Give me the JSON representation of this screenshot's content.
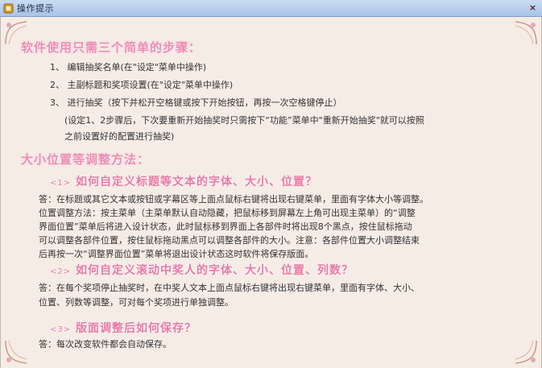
{
  "window": {
    "title": "操作提示",
    "close_label": "×"
  },
  "section1": {
    "heading": "软件使用只需三个简单的步骤：",
    "steps": [
      "1、 编辑抽奖名单(在\"设定\"菜单中操作)",
      "2、 主副标题和奖项设置(在\"设定\"菜单中操作)",
      "3、 进行抽奖（按下并松开空格键或按下开始按钮，再按一次空格键停止）"
    ],
    "note_lines": [
      "(设定1、2步骤后，下次要重新开始抽奖时只需按下“功能”菜单中\"重新开始抽奖\"就可以按照",
      "之前设置好的配置进行抽奖)"
    ]
  },
  "section2": {
    "heading": "大小位置等调整方法：",
    "questions": [
      {
        "num": "<1>",
        "title": "如何自定义标题等文本的字体、大小、位置？",
        "answer_lines": [
          "答：在标题或其它文本或按钮或字幕区等上面点鼠标右键将出现右键菜单，里面有字体大小等调整。",
          "位置调整方法：按主菜单（主菜单默认自动隐藏，把鼠标移到屏幕左上角可出现主菜单）的“调整",
          "界面位置”菜单后将进入设计状态，此时鼠标移到界面上各部件时将出现8个黑点，按住鼠标拖动",
          "可以调整各部件位置，按住鼠标拖动黑点可以调整各部件的大小。注意：各部件位置大小调整结束",
          "后再按一次“调整界面位置”菜单将退出设计状态这时软件将保存版面。"
        ]
      },
      {
        "num": "<2>",
        "title": "如何自定义滚动中奖人的字体、大小、位置、列数？",
        "answer_lines": [
          "答：在每个奖项停止抽奖时，在中奖人文本上面点鼠标右键将出现右键菜单，里面有字体、大小、",
          "位置、列数等调整，可对每个奖项进行单独调整。"
        ]
      },
      {
        "num": "<3>",
        "title": "版面调整后如何保存？",
        "answer_lines": [
          "答：每次改变软件都会自动保存。"
        ]
      }
    ]
  },
  "colors": {
    "heading_pink": "#ec8db2",
    "panel_bg": "#f6ece6",
    "titlebar": "#b7cfee"
  }
}
